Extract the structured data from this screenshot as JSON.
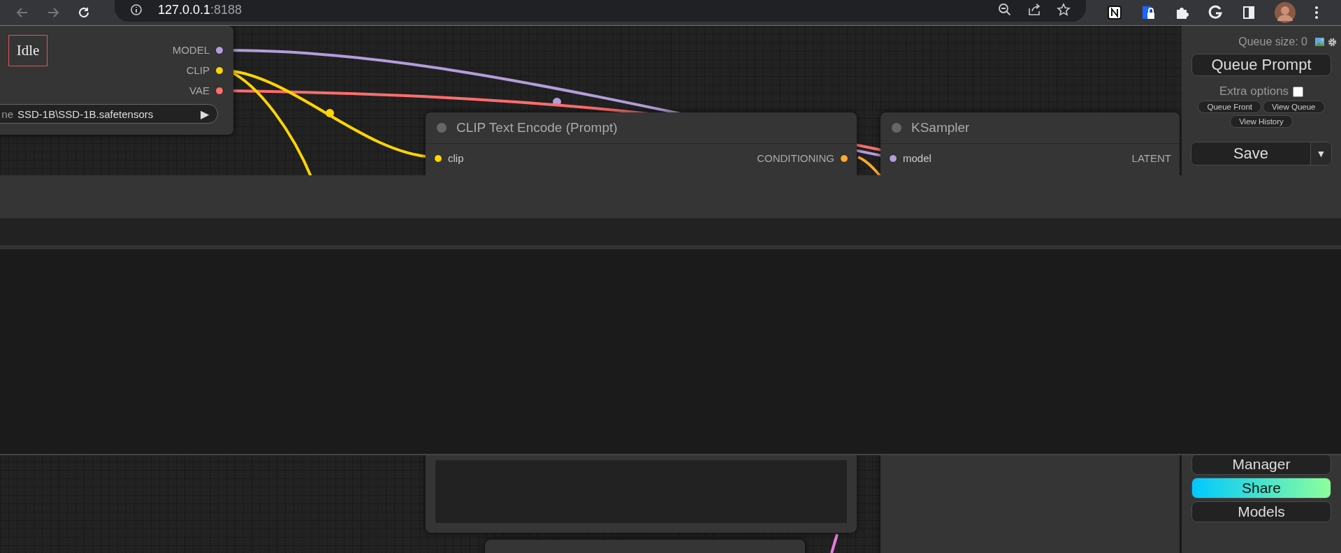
{
  "browser": {
    "host": "127.0.0.1",
    "port": ":8188"
  },
  "status": "Idle",
  "loader": {
    "outputs": [
      {
        "label": "MODEL",
        "color": "#b39ddb"
      },
      {
        "label": "CLIP",
        "color": "#ffd500"
      },
      {
        "label": "VAE",
        "color": "#ff6e6e"
      }
    ],
    "widget_label": "ne",
    "widget_value": "SSD-1B\\SSD-1B.safetensors",
    "widget_arrow": "▶"
  },
  "clip_node": {
    "title": "CLIP Text Encode (Prompt)",
    "input": {
      "label": "clip",
      "color": "#ffd500"
    },
    "output": {
      "label": "CONDITIONING",
      "color": "#ffa931"
    }
  },
  "ksampler": {
    "title": "KSampler",
    "input": {
      "label": "model",
      "color": "#b39ddb"
    },
    "output": "LATENT"
  },
  "panel": {
    "queue_size": "Queue size: 0",
    "queue_prompt": "Queue Prompt",
    "extra_options": "Extra options",
    "extra_checked": false,
    "small_buttons": [
      "Queue Front",
      "View Queue"
    ],
    "view_history": "View History",
    "save": "Save",
    "save_arrow": "▼",
    "bottom_buttons": [
      {
        "label": "Manager",
        "kind": "plain"
      },
      {
        "label": "Share",
        "kind": "gradient"
      },
      {
        "label": "Models",
        "kind": "plain"
      }
    ]
  }
}
